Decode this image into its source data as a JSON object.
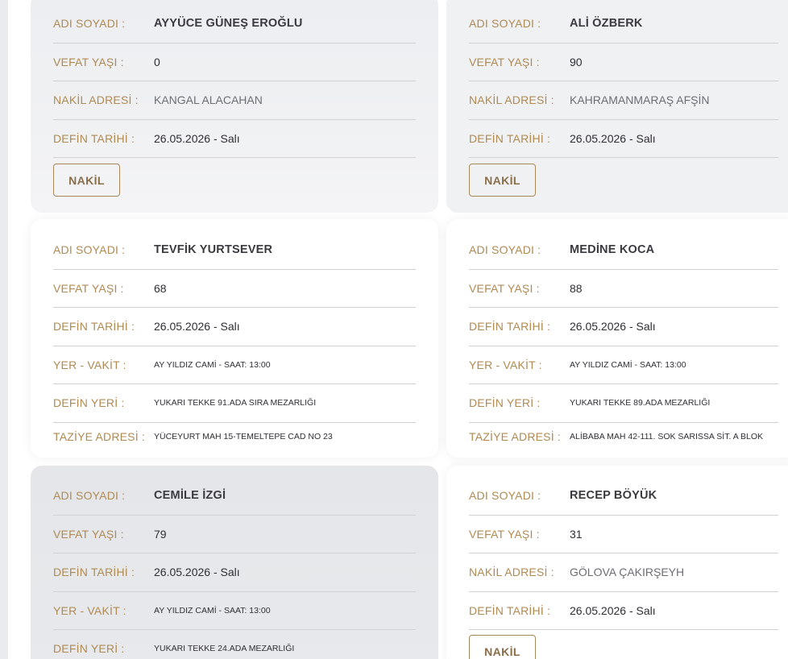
{
  "labels": {
    "name": "ADI SOYADI :",
    "age": "VEFAT YAŞI :",
    "transfer": "NAKİL ADRESİ :",
    "burial_date": "DEFİN TARİHİ :",
    "place_time": "YER - VAKİT :",
    "burial_place": "DEFİN YERİ :",
    "condolence": "TAZİYE ADRESİ :",
    "button": "NAKİL"
  },
  "cards": [
    {
      "name": "AYYÜCE GÜNEŞ EROĞLU",
      "age": "0",
      "transfer": "KANGAL ALACAHAN",
      "burial_date": "26.05.2026 - Salı"
    },
    {
      "name": "ALİ ÖZBERK",
      "age": "90",
      "transfer": "KAHRAMANMARAŞ AFŞİN",
      "burial_date": "26.05.2026 - Salı"
    },
    {
      "name": "TEVFİK YURTSEVER",
      "age": "68",
      "burial_date": "26.05.2026 - Salı",
      "place_time": "AY YILDIZ CAMİ - SAAT: 13:00",
      "burial_place": "YUKARI TEKKE 91.ADA SIRA MEZARLIĞI",
      "condolence": "YÜCEYURT MAH 15-TEMELTEPE CAD NO 23"
    },
    {
      "name": "MEDİNE KOCA",
      "age": "88",
      "burial_date": "26.05.2026 - Salı",
      "place_time": "AY YILDIZ CAMİ - SAAT: 13:00",
      "burial_place": "YUKARI TEKKE 89.ADA MEZARLIĞI",
      "condolence": "ALİBABA MAH 42-111. SOK SARISSA SİT. A BLOK"
    },
    {
      "name": "CEMİLE İZGİ",
      "age": "79",
      "burial_date": "26.05.2026 - Salı",
      "place_time": "AY YILDIZ CAMİ - SAAT: 13:00",
      "burial_place": "YUKARI TEKKE 24.ADA MEZARLIĞI"
    },
    {
      "name": "RECEP BÖYÜK",
      "age": "31",
      "transfer": "GÖLOVA ÇAKIRŞEYH",
      "burial_date": "26.05.2026 - Salı"
    }
  ],
  "colors": {
    "label_gold": "#b08a52",
    "value_dark": "#2f2f34",
    "divider": "#cfd1d4",
    "button_border": "#a8875a"
  }
}
